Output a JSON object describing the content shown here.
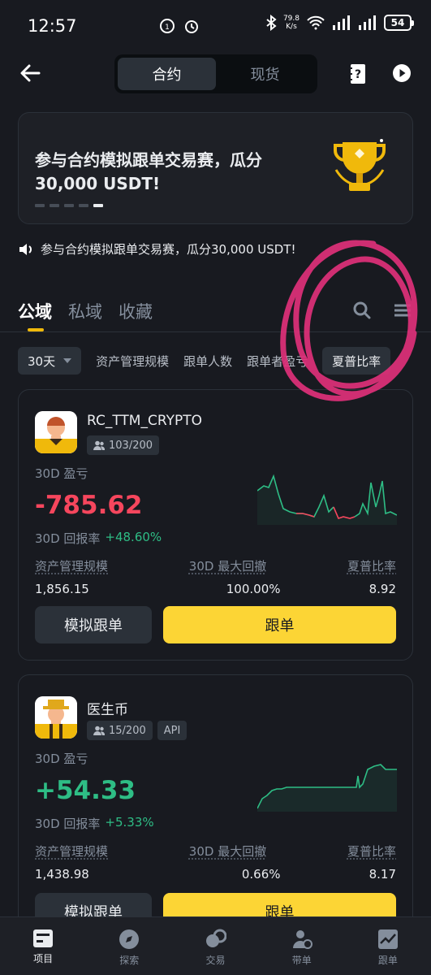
{
  "status": {
    "time": "12:57",
    "speed_value": "79.8",
    "speed_unit": "K/s",
    "battery": "54"
  },
  "header": {
    "tabs": [
      "合约",
      "现货"
    ]
  },
  "banner": {
    "title": "参与合约模拟跟单交易赛，瓜分30,000 USDT!"
  },
  "notice": {
    "text": "参与合约模拟跟单交易赛，瓜分30,000 USDT!"
  },
  "tabs": [
    "公域",
    "私域",
    "收藏"
  ],
  "filters": {
    "period": "30天",
    "items": [
      "资产管理规模",
      "跟单人数",
      "跟单者盈亏",
      "夏普比率"
    ]
  },
  "colors": {
    "accent": "#fcd535",
    "profit": "#2ebd85",
    "loss": "#f6465d"
  },
  "cards": [
    {
      "name": "RC_TTM_CRYPTO",
      "followers": "103/200",
      "pnl_label": "30D 盈亏",
      "pnl": "-785.62",
      "roi_label": "30D 回报率",
      "roi": "+48.60%",
      "stat_labels": [
        "资产管理规模",
        "30D 最大回撤",
        "夏普比率"
      ],
      "stat_values": [
        "1,856.15",
        "100.00%",
        "8.92"
      ],
      "mock_button": "模拟跟单",
      "follow_button": "跟单"
    },
    {
      "name": "医生币",
      "followers": "15/200",
      "api": "API",
      "pnl_label": "30D 盈亏",
      "pnl": "+54.33",
      "roi_label": "30D 回报率",
      "roi": "+5.33%",
      "stat_labels": [
        "资产管理规模",
        "30D 最大回撤",
        "夏普比率"
      ],
      "stat_values": [
        "1,438.98",
        "0.66%",
        "8.17"
      ],
      "mock_button": "模拟跟单",
      "follow_button": "跟单"
    }
  ],
  "nav": [
    "项目",
    "探索",
    "交易",
    "带单",
    "跟单"
  ]
}
